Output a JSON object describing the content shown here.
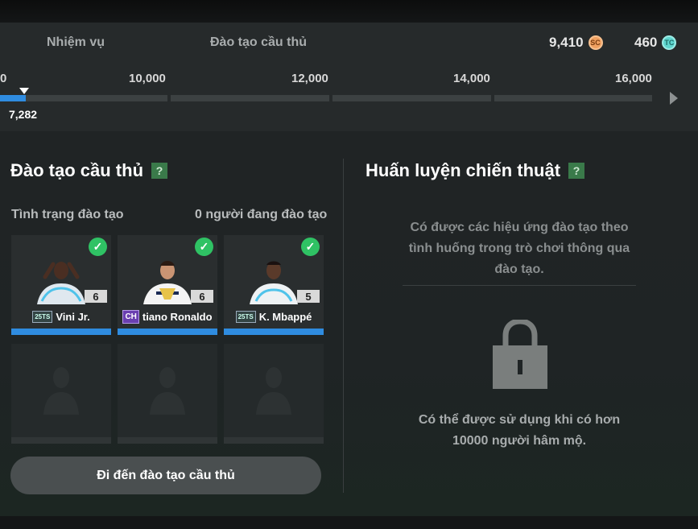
{
  "header": {
    "tabs": [
      "Nhiệm vụ",
      "Đào tạo cầu thủ"
    ],
    "currencies": [
      {
        "value": "9,410",
        "icon": "sc-coin-icon",
        "code": "SC"
      },
      {
        "value": "460",
        "icon": "tc-coin-icon",
        "code": "TC"
      }
    ]
  },
  "progress": {
    "start_tick": "0",
    "ticks": [
      "10,000",
      "12,000",
      "14,000",
      "16,000"
    ],
    "current_value": "7,282"
  },
  "training": {
    "title": "Đào tạo cầu thủ",
    "help": "?",
    "status_label": "Tình trạng đào tạo",
    "count_label": "0 người đang đào tạo",
    "players": [
      {
        "name": "Vini Jr.",
        "season": "25TS",
        "level": "6"
      },
      {
        "name": "tiano Ronaldo",
        "season": "CH",
        "level": "6"
      },
      {
        "name": "K. Mbappé",
        "season": "25TS",
        "level": "5"
      }
    ],
    "button": "Đi đến đào tạo cầu thủ"
  },
  "tactics": {
    "title": "Huấn luyện chiến thuật",
    "help": "?",
    "description": "Có được các hiệu ứng đào tạo theo tình huống trong trò chơi thông qua đào tạo.",
    "locked_message": "Có thể được sử dụng khi có hơn 10000 người hâm mộ."
  },
  "colors": {
    "accent": "#2f8ce0",
    "check": "#2fc264",
    "help_icon": "#3a7a4a"
  }
}
